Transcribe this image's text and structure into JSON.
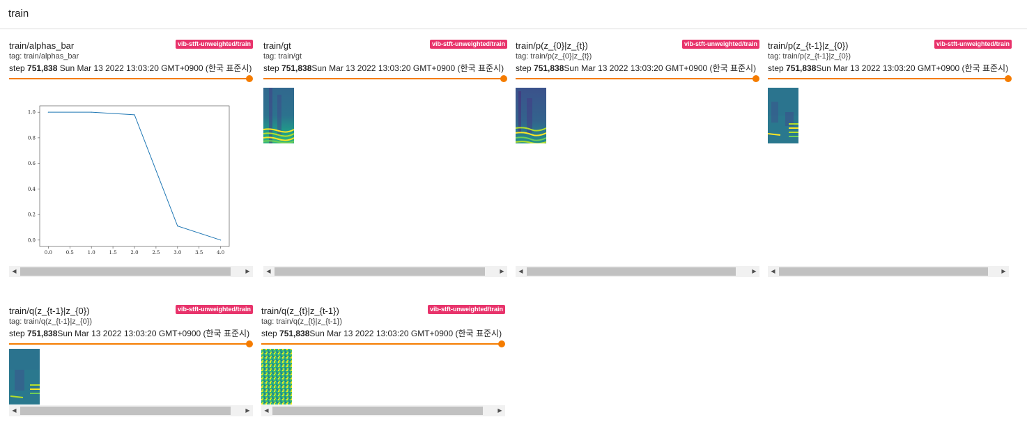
{
  "header": {
    "title": "train"
  },
  "run_badge": "vib-stft-unweighted/train",
  "step_label": "step",
  "step_value": "751,838",
  "timestamp": "Sun Mar 13 2022 13:03:20 GMT+0900 (한국 표준시)",
  "colors": {
    "accent": "#f57c00",
    "badge": "#e8336b",
    "plot_line": "#1f77b4"
  },
  "cards": [
    {
      "title": "train/alphas_bar",
      "tag": "tag: train/alphas_bar",
      "kind": "plot"
    },
    {
      "title": "train/gt",
      "tag": "tag: train/gt",
      "kind": "spectrogram-gt"
    },
    {
      "title": "train/p(z_{0}|z_{t})",
      "tag": "tag: train/p(z_{0}|z_{t})",
      "kind": "spectrogram-p0"
    },
    {
      "title": "train/p(z_{t-1}|z_{0})",
      "tag": "tag: train/p(z_{t-1}|z_{0})",
      "kind": "spectrogram-pt"
    },
    {
      "title": "train/q(z_{t-1}|z_{0})",
      "tag": "tag: train/q(z_{t-1}|z_{0})",
      "kind": "spectrogram-q1"
    },
    {
      "title": "train/q(z_{t}|z_{t-1})",
      "tag": "tag: train/q(z_{t}|z_{t-1})",
      "kind": "spectrogram-noise"
    }
  ],
  "chart_data": {
    "type": "line",
    "x": [
      0.0,
      1.0,
      2.0,
      3.0,
      4.0
    ],
    "values": [
      1.0,
      1.0,
      0.98,
      0.11,
      0.0
    ],
    "xticks": [
      "0.0",
      "0.5",
      "1.0",
      "1.5",
      "2.0",
      "2.5",
      "3.0",
      "3.5",
      "4.0"
    ],
    "yticks": [
      "0.0",
      "0.2",
      "0.4",
      "0.6",
      "0.8",
      "1.0"
    ],
    "xlim": [
      -0.2,
      4.2
    ],
    "ylim": [
      -0.05,
      1.05
    ],
    "grid": false
  }
}
